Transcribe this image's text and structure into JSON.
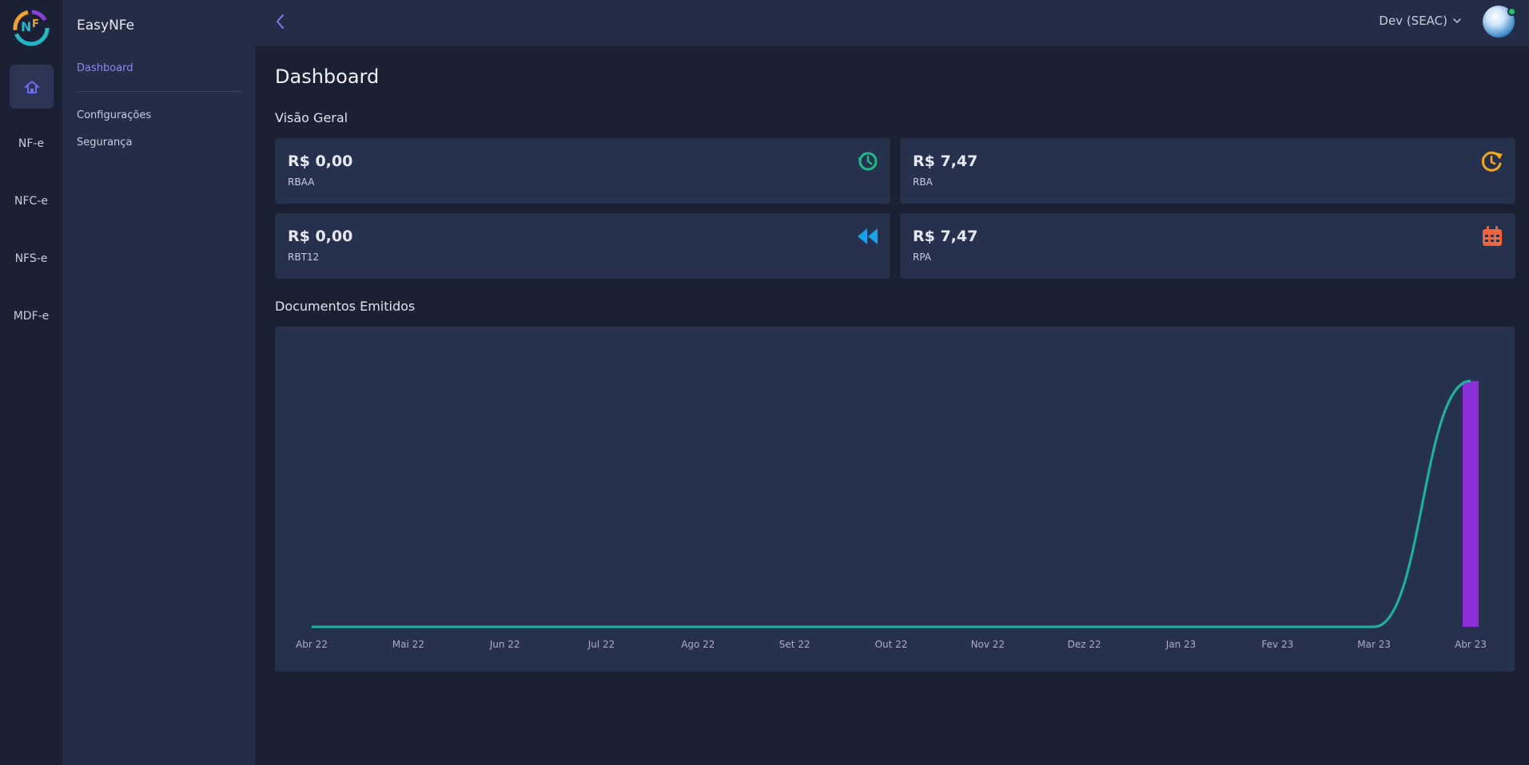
{
  "app": {
    "name": "EasyNFe"
  },
  "rail": {
    "items": [
      {
        "label": "NF-e"
      },
      {
        "label": "NFC-e"
      },
      {
        "label": "NFS-e"
      },
      {
        "label": "MDF-e"
      }
    ]
  },
  "sidebar": {
    "items": [
      {
        "label": "Dashboard",
        "active": true
      },
      {
        "label": "Configurações"
      },
      {
        "label": "Segurança"
      }
    ]
  },
  "header": {
    "org_selector": "Dev (SEAC)"
  },
  "main": {
    "title": "Dashboard",
    "overview_title": "Visão Geral",
    "cards": [
      {
        "value": "R$ 0,00",
        "label": "RBAA",
        "icon": "history-icon",
        "color": "#1fb98a"
      },
      {
        "value": "R$ 7,47",
        "label": "RBA",
        "icon": "clock-refresh-icon",
        "color": "#f5a623"
      },
      {
        "value": "R$ 0,00",
        "label": "RBT12",
        "icon": "rewind-icon",
        "color": "#1ba3e8"
      },
      {
        "value": "R$ 7,47",
        "label": "RPA",
        "icon": "calendar-icon",
        "color": "#f0643a"
      }
    ],
    "documents_title": "Documentos Emitidos"
  },
  "chart_data": {
    "type": "bar",
    "categories": [
      "Abr 22",
      "Mai 22",
      "Jun 22",
      "Jul 22",
      "Ago 22",
      "Set 22",
      "Out 22",
      "Nov 22",
      "Dez 22",
      "Jan 23",
      "Fev 23",
      "Mar 23",
      "Abr 23"
    ],
    "series": [
      {
        "type": "line",
        "values": [
          0,
          0,
          0,
          0,
          0,
          0,
          0,
          0,
          0,
          0,
          0,
          0,
          1
        ],
        "color": "#1fb4a2"
      },
      {
        "type": "bar",
        "values": [
          0,
          0,
          0,
          0,
          0,
          0,
          0,
          0,
          0,
          0,
          0,
          0,
          1
        ],
        "color": "#8a2fd8"
      }
    ],
    "ylim": [
      0,
      1
    ],
    "grid": false,
    "legend": "none"
  }
}
